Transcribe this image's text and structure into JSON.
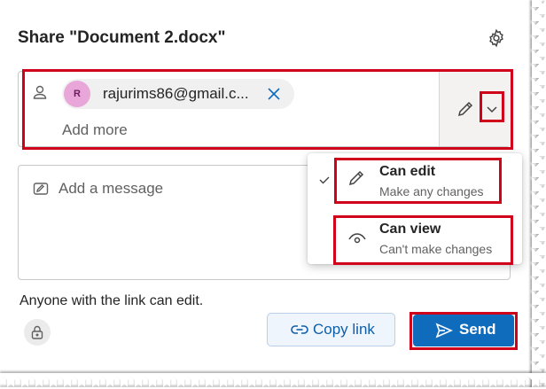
{
  "dialog": {
    "title": "Share \"Document 2.docx\"",
    "settings_icon": "gear-icon"
  },
  "recipients": {
    "person_icon": "person-icon",
    "chip": {
      "avatar_initial": "R",
      "email": "rajurims86@gmail.c...",
      "remove_icon": "close-icon"
    },
    "add_more_placeholder": "Add more",
    "permission_icon": "pencil-icon",
    "dropdown_icon": "chevron-down-icon"
  },
  "message": {
    "icon": "edit-message-icon",
    "placeholder": "Add a message"
  },
  "permission_menu": {
    "selected": "Can edit",
    "options": [
      {
        "title": "Can edit",
        "subtitle": "Make any changes",
        "icon": "pencil-icon",
        "selected": true
      },
      {
        "title": "Can view",
        "subtitle": "Can't make changes",
        "icon": "eye-icon",
        "selected": false
      }
    ]
  },
  "footer": {
    "link_info": "Anyone with the link can edit.",
    "lock_icon": "lock-icon",
    "copy_link_label": "Copy link",
    "send_label": "Send"
  },
  "colors": {
    "accent": "#0f6cbd",
    "highlight_border": "#d0021b",
    "avatar_bg": "#e8a6d9"
  }
}
